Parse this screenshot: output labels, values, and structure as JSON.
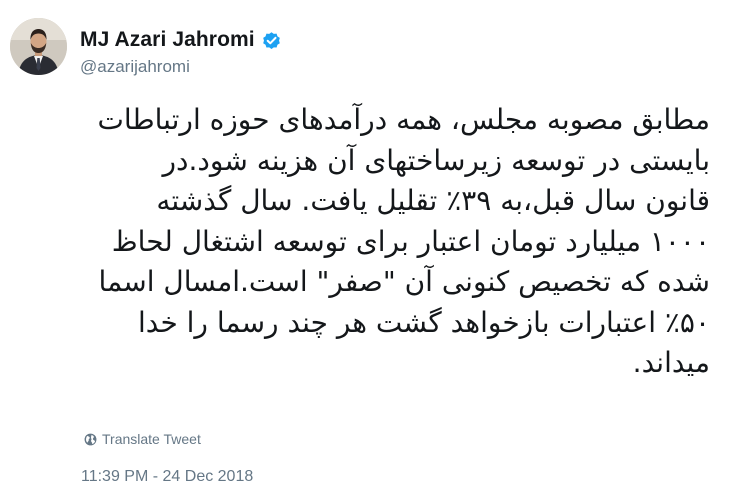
{
  "tweet": {
    "display_name": "MJ Azari Jahromi",
    "handle": "@azarijahromi",
    "verified_icon": "verified-badge-icon",
    "avatar_icon": "profile-photo",
    "text": "مطابق مصوبه مجلس، همه درآمدهای حوزه ارتباطات بایستی در توسعه زیرساختهای آن هزینه شود.در قانون سال قبل،به ۳۹٪ تقلیل یافت. سال گذشته ۱۰۰۰ میلیارد تومان اعتبار برای توسعه اشتغال لحاظ شده که تخصیص کنونی آن \"صفر\" است.امسال اسما ۵۰٪ اعتبارات بازخواهد گشت هر چند رسما را خدا میداند.",
    "translate_label": "Translate Tweet",
    "translate_icon": "globe-icon",
    "timestamp": "11:39 PM - 24 Dec 2018"
  },
  "colors": {
    "text": "#14171a",
    "secondary": "#657786",
    "verified_blue": "#1da1f2",
    "background": "#ffffff"
  }
}
